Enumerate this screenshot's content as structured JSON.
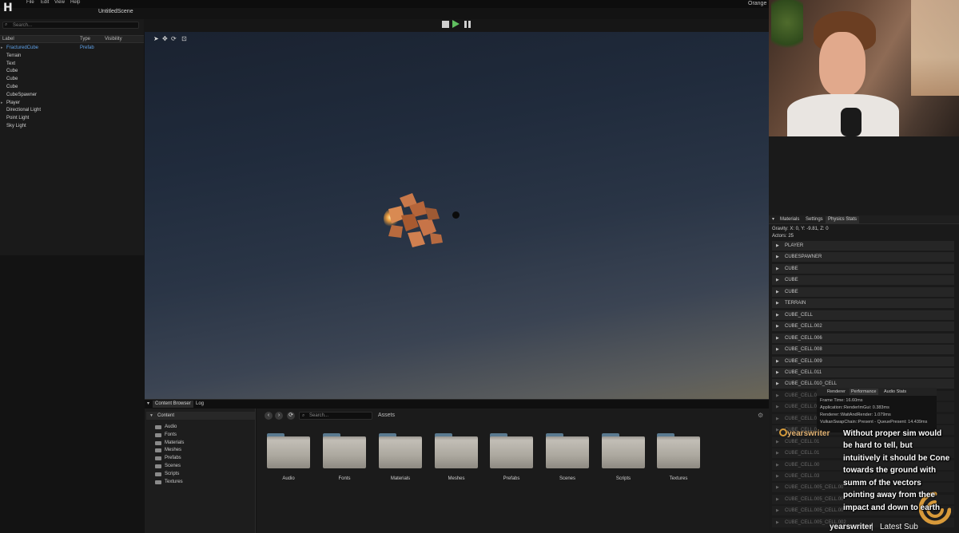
{
  "app": {
    "logo": "H",
    "scene_title": "UntitledScene",
    "top_right_label": "Orange",
    "menu": [
      "File",
      "Edit",
      "View",
      "Help"
    ]
  },
  "hierarchy": {
    "search_placeholder": "Search...",
    "columns": [
      "Label",
      "Type",
      "Visibility"
    ],
    "rows": [
      {
        "label": "FracturedCube",
        "type": "Prefab",
        "selected": true,
        "expandable": true
      },
      {
        "label": "Terrain"
      },
      {
        "label": "Text"
      },
      {
        "label": "Cube"
      },
      {
        "label": "Cube"
      },
      {
        "label": "Cube"
      },
      {
        "label": "CubeSpawner"
      },
      {
        "label": "Player",
        "expandable": true
      },
      {
        "label": "Directional Light"
      },
      {
        "label": "Point Light"
      },
      {
        "label": "Sky Light"
      }
    ]
  },
  "viewport": {
    "tools": [
      "select-icon",
      "move-icon",
      "rotate-icon",
      "scale-icon"
    ],
    "controls": [
      "stop",
      "play",
      "pause"
    ]
  },
  "content_browser": {
    "tabs": [
      "Content Browser",
      "Log"
    ],
    "tree_root": "Content",
    "tree_items": [
      "Audio",
      "Fonts",
      "Materials",
      "Meshes",
      "Prefabs",
      "Scenes",
      "Scripts",
      "Textures"
    ],
    "search_placeholder": "Search...",
    "assets_label": "Assets",
    "folders": [
      "Audio",
      "Fonts",
      "Materials",
      "Meshes",
      "Prefabs",
      "Scenes",
      "Scripts",
      "Textures"
    ]
  },
  "right_panel": {
    "tabs": [
      "Materials",
      "Settings",
      "Physics Stats"
    ],
    "gravity": "Gravity: X: 0, Y: -9.81, Z: 0",
    "actors": "Actors: 25",
    "physics_rows": [
      "PLAYER",
      "CUBESPAWNER",
      "CUBE",
      "CUBE",
      "CUBE",
      "TERRAIN",
      "CUBE_CELL",
      "CUBE_CELL.002",
      "CUBE_CELL.006",
      "CUBE_CELL.008",
      "CUBE_CELL.009",
      "CUBE_CELL.011",
      "CUBE_CELL.010_CELL",
      "CUBE_CELL.01",
      "CUBE_CELL.01",
      "CUBE_CELL.01",
      "CUBE_CELL.01",
      "CUBE_CELL.01",
      "CUBE_CELL.01",
      "CUBE_CELL.00",
      "CUBE_CELL.03",
      "CUBE_CELL.005_CELL.00",
      "CUBE_CELL.005_CELL.00",
      "CUBE_CELL.005_CELL.00",
      "CUBE_CELL.005_CELL.002"
    ]
  },
  "renderer": {
    "tabs": [
      "Renderer",
      "Performance",
      "Audio Stats"
    ],
    "lines": [
      "Frame Time: 16.60ms",
      "Application::RenderImGui: 0.383ms",
      "Renderer::WaitAndRender: 1.079ms",
      "VulkanSwapChain::Present - QueuePresent: 14.439ms"
    ]
  },
  "chat": {
    "user": "yearswriter",
    "lines": [
      "Without proper sim would",
      "be hard to tell, but",
      "intuitively it should be Cone",
      "towards the ground with",
      "summ of the vectors",
      "pointing away from thee",
      "impact and down to earth"
    ],
    "latest_sub_user": "yearswriter",
    "latest_sub_sep": "|",
    "latest_sub_label": "Latest Sub"
  },
  "colors": {
    "accent_blue": "#5ea0e6",
    "play_green": "#5fbf5f",
    "chat_user": "#e0b070"
  }
}
